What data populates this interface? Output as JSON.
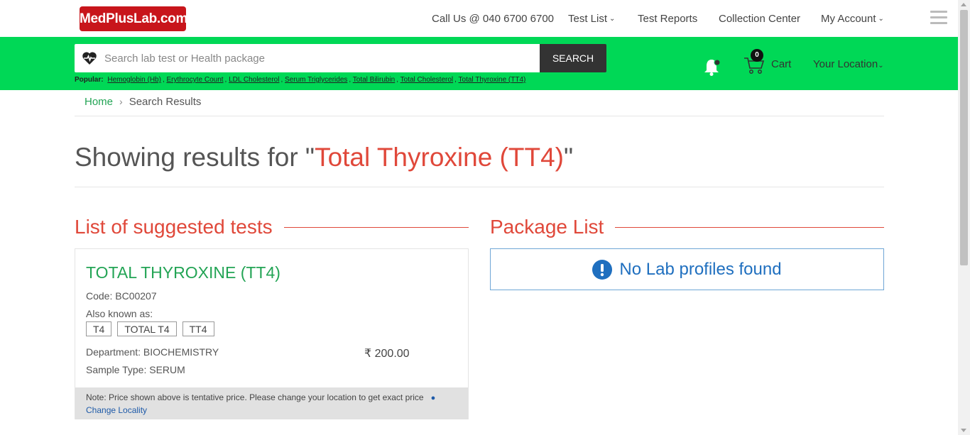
{
  "header": {
    "logo": "MedPlusLab.com",
    "nav": [
      {
        "label": "Call Us @ 040 6700 6700",
        "has_dropdown": false
      },
      {
        "label": "Test List",
        "has_dropdown": true
      },
      {
        "label": "Test Reports",
        "has_dropdown": false
      },
      {
        "label": "Collection Center",
        "has_dropdown": false
      },
      {
        "label": "My Account",
        "has_dropdown": true
      }
    ]
  },
  "search": {
    "placeholder": "Search lab test or Health package",
    "button_label": "SEARCH",
    "popular_label": "Popular:",
    "popular": [
      "Hemoglobin (Hb)",
      "Erythrocyte Count",
      "LDL Cholesterol",
      "Serum Triglycerides",
      "Total Bilirubin",
      "Total Cholesterol",
      "Total Thyroxine (TT4)"
    ]
  },
  "cart": {
    "count": "0",
    "label": "Cart"
  },
  "location_label": "Your Location",
  "breadcrumb": {
    "home": "Home",
    "current": "Search Results"
  },
  "results": {
    "prefix": "Showing results for \"",
    "query": "Total Thyroxine (TT4)",
    "suffix": "\""
  },
  "tests_section": {
    "title": "List of suggested tests",
    "tests": [
      {
        "name": "TOTAL THYROXINE (TT4)",
        "code": "Code: BC00207",
        "aka_label": "Also known as:",
        "aka": [
          "T4",
          "TOTAL T4",
          "TT4"
        ],
        "department": "Department: BIOCHEMISTRY",
        "sample_type": "Sample Type: SERUM",
        "price": "₹ 200.00",
        "note": "Note: Price shown above is tentative price. Please change your location to get exact price",
        "change_locality": "Change Locality"
      }
    ]
  },
  "package_section": {
    "title": "Package List",
    "empty_message": "No Lab profiles found"
  },
  "colors": {
    "brand_red": "#c8151b",
    "accent_green": "#00d856",
    "link_green": "#23a455",
    "heading_red": "#e0483a",
    "info_blue": "#1f6fbf"
  }
}
